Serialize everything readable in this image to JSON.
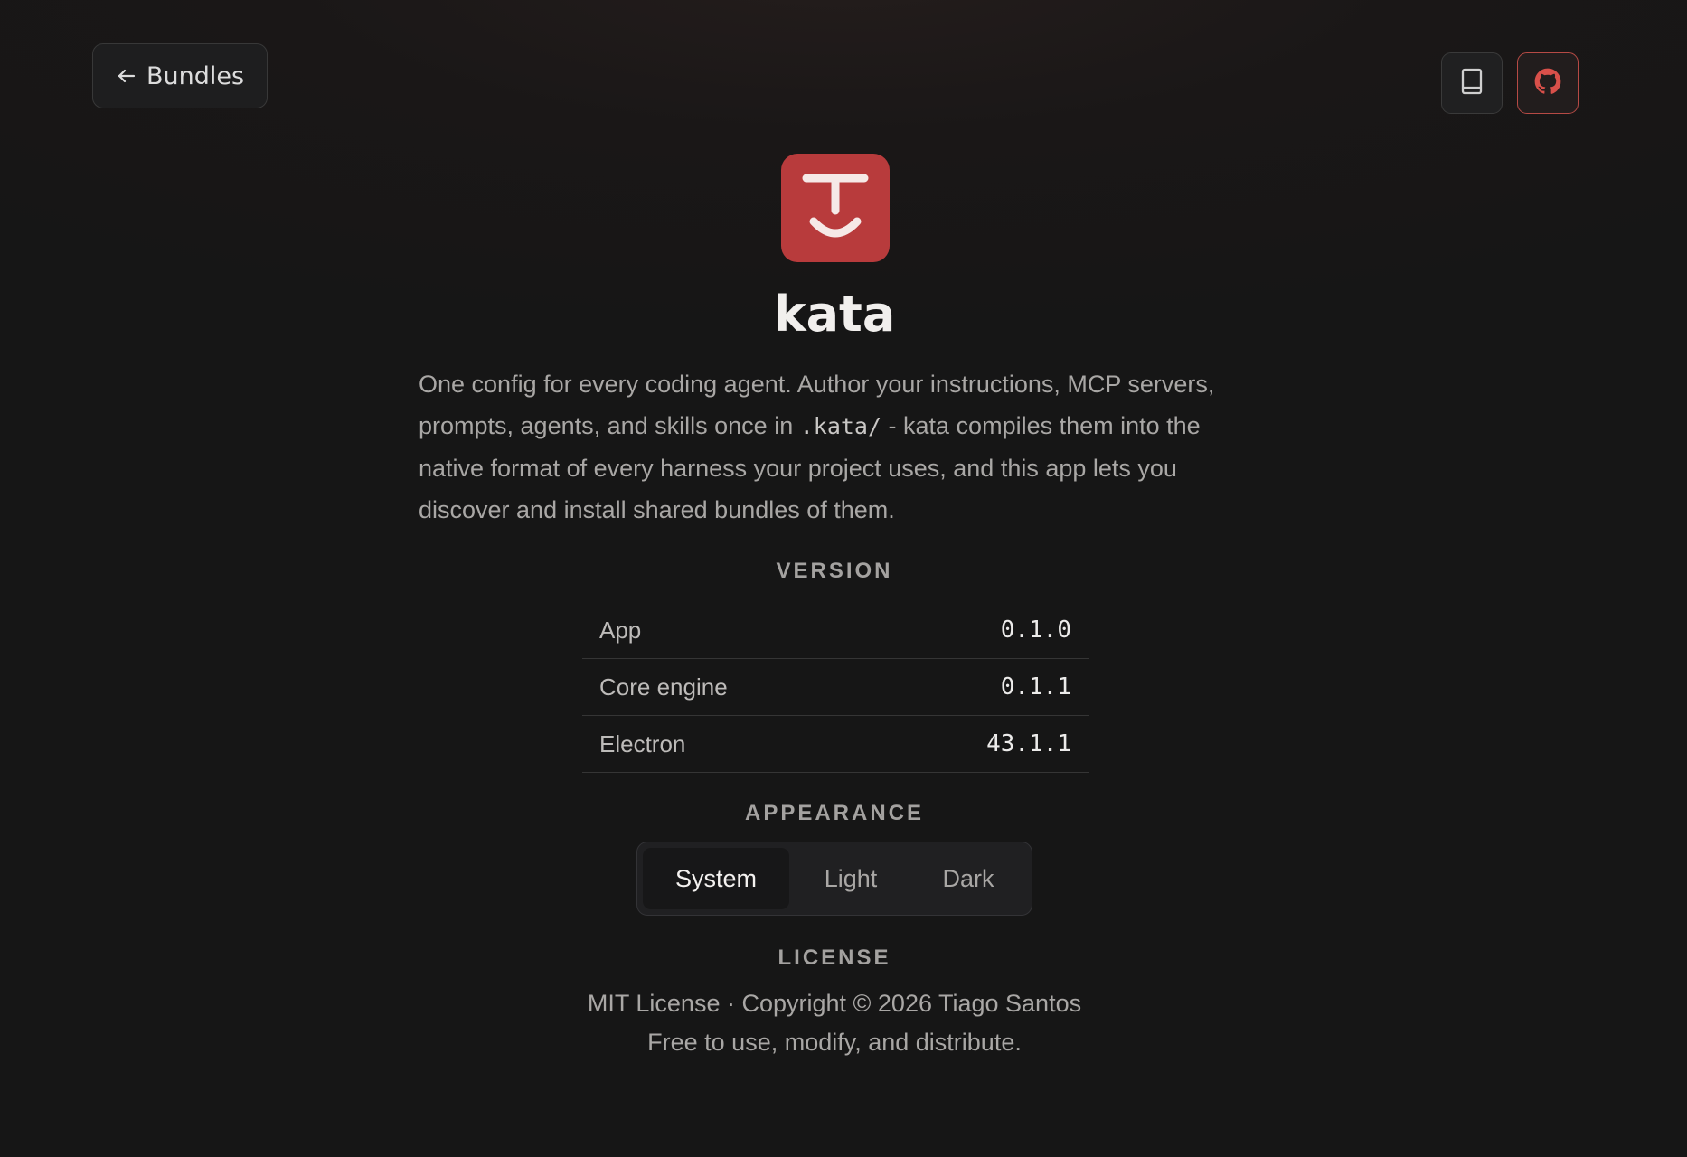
{
  "header": {
    "back_label": "Bundles",
    "back_icon": "arrow-left-icon",
    "docs_icon": "book-icon",
    "github_icon": "github-icon"
  },
  "app": {
    "name": "kata",
    "logo_icon": "kata-logo-icon",
    "brand_color": "#b83b3c",
    "description_part1": "One config for every coding agent. Author your instructions, MCP servers, prompts, agents, and skills once in ",
    "description_code": ".kata/",
    "description_part2": " - kata compiles them into the native format of every harness your project uses, and this app lets you discover and install shared bundles of them."
  },
  "version": {
    "label": "VERSION",
    "rows": [
      {
        "key": "App",
        "value": "0.1.0"
      },
      {
        "key": "Core engine",
        "value": "0.1.1"
      },
      {
        "key": "Electron",
        "value": "43.1.1"
      }
    ]
  },
  "appearance": {
    "label": "APPEARANCE",
    "options": [
      "System",
      "Light",
      "Dark"
    ],
    "selected": "System"
  },
  "license": {
    "label": "LICENSE",
    "line1": "MIT License · Copyright © 2026 Tiago Santos",
    "line2": "Free to use, modify, and distribute."
  }
}
